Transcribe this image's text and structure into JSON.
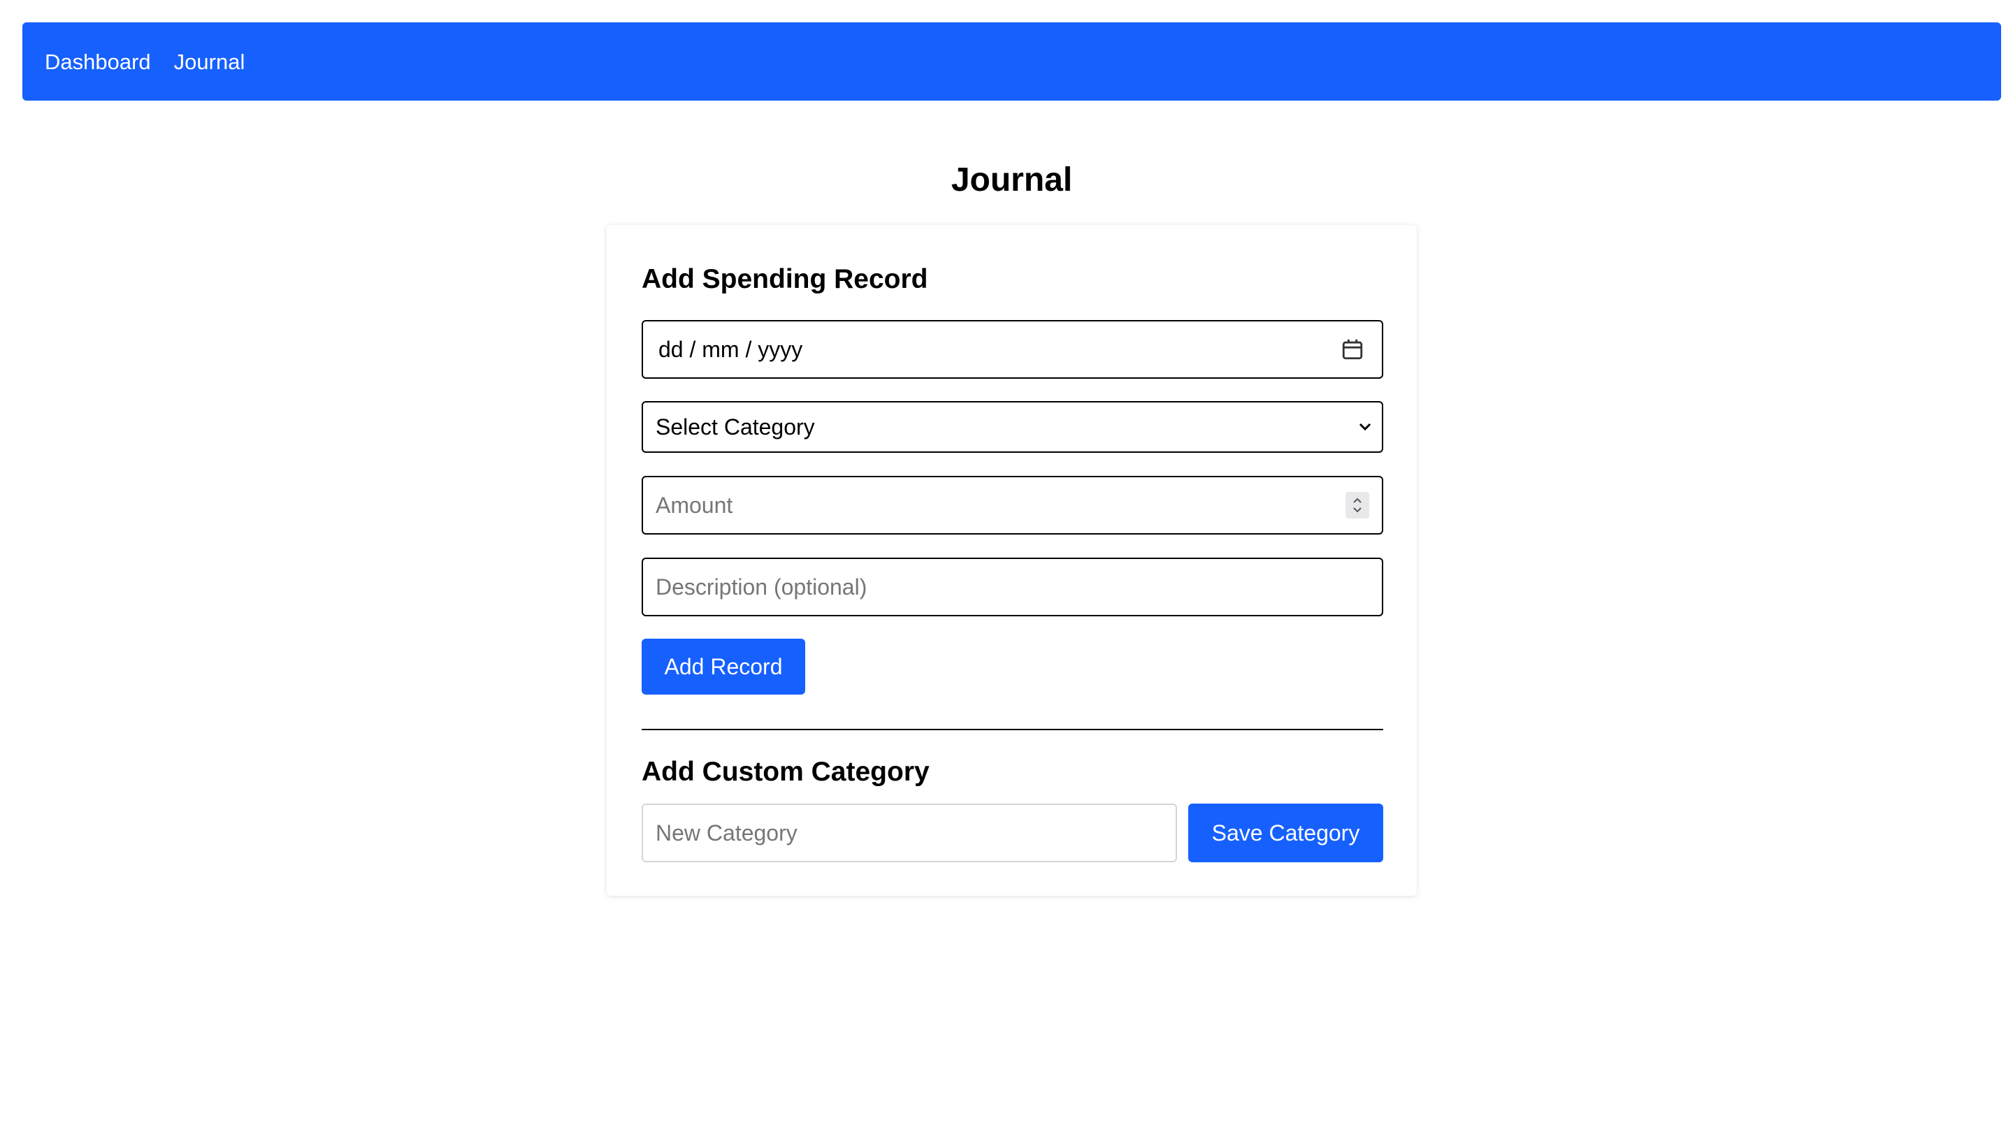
{
  "nav": {
    "links": [
      {
        "label": "Dashboard"
      },
      {
        "label": "Journal"
      }
    ],
    "background_color": "#1660fe"
  },
  "page": {
    "title": "Journal"
  },
  "spending_form": {
    "title": "Add Spending Record",
    "date": {
      "value": "dd / mm / yyyy",
      "icon": "calendar-icon"
    },
    "category": {
      "selected": "Select Category",
      "icon": "chevron-down-icon"
    },
    "amount": {
      "placeholder": "Amount",
      "icon": "stepper-icon"
    },
    "description": {
      "placeholder": "Description (optional)"
    },
    "submit_label": "Add Record"
  },
  "custom_category": {
    "title": "Add Custom Category",
    "input_placeholder": "New Category",
    "save_label": "Save Category"
  },
  "colors": {
    "accent": "#1660fe",
    "placeholder": "#767676"
  }
}
